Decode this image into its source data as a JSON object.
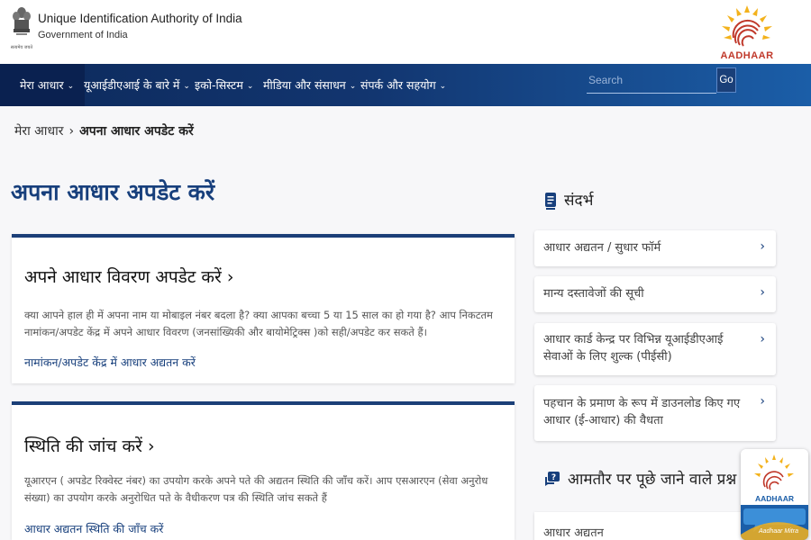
{
  "header": {
    "org_name": "Unique Identification Authority of India",
    "org_sub": "Government of India",
    "emblem_icon": "national-emblem-icon",
    "logo_text": "AADHAAR"
  },
  "nav": {
    "items": [
      {
        "label": "मेरा आधार"
      },
      {
        "label": "यूआईडीएआई के बारे में"
      },
      {
        "label": "इको-सिस्टम"
      },
      {
        "label": "मीडिया और संसाधन"
      },
      {
        "label": "संपर्क और सहयोग"
      }
    ],
    "search_placeholder": "Search",
    "search_value": "",
    "go_label": "Go"
  },
  "breadcrumb": {
    "home": "मेरा आधार",
    "separator": "›",
    "current": "अपना आधार अपडेट करें"
  },
  "page_title": "अपना आधार अपडेट करें",
  "cards": [
    {
      "heading": "अपने आधार विवरण अपडेट करें ›",
      "text": "क्या आपने हाल ही में अपना नाम या मोबाइल नंबर बदला है? क्या आपका बच्चा 5 या 15 साल का हो गया है? आप निकटतम नामांकन/अपडेट केंद्र में अपने आधार विवरण (जनसांख्यिकी और बायोमेट्रिक्स )को सही/अपडेट कर सकते हैं।",
      "link": "नामांकन/अपडेट केंद्र में आधार अद्यतन करें"
    },
    {
      "heading": "स्थिति की जांच करें ›",
      "text": "यूआरएन ( अपडेट रिक्वेस्ट नंबर) का उपयोग करके अपने पते की अद्यतन स्थिति की जाँच करें। आप एसआरएन (सेवा अनुरोध संख्या) का उपयोग करके अनुरोधित पते के वैधीकरण पत्र की स्थिति जांच सकते हैं",
      "link": "आधार अद्यतन स्थिति की जाँच करें"
    }
  ],
  "references": {
    "title": "संदर्भ",
    "icon": "document-icon",
    "items": [
      {
        "label": "आधार अद्यतन / सुधार फॉर्म"
      },
      {
        "label": "मान्य दस्तावेजों की सूची"
      },
      {
        "label": "आधार कार्ड केन्द्र पर विभिन्न यूआईडीएआई सेवाओं के लिए शुल्क (पीईसी)"
      },
      {
        "label": "पहचान के प्रमाण के रूप में डाउनलोड किए गए आधार (ई-आधार) की वैधता"
      }
    ],
    "arrow": "›"
  },
  "faq": {
    "title": "आमतौर पर पूछे जाने वाले प्रश्न",
    "icon": "faq-chat-icon",
    "items": [
      {
        "label": "आधार अद्यतन"
      }
    ]
  },
  "mitra": {
    "logo_text": "AADHAAR",
    "label": "Aadhaar Mitra"
  },
  "colors": {
    "nav_dark": "#0d2a5c",
    "nav_light": "#1b5ea8",
    "title_blue": "#173f7c",
    "aadhaar_red": "#c0392b",
    "aadhaar_yellow": "#f3b21c"
  }
}
